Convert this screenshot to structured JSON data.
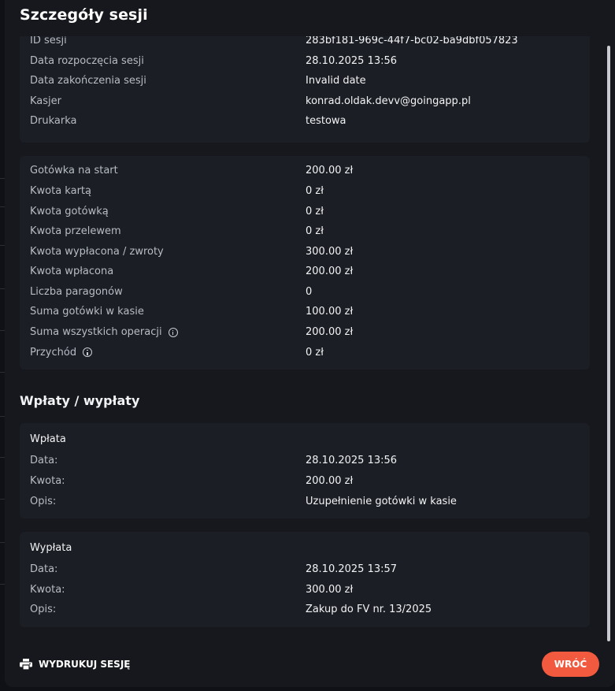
{
  "modal": {
    "title": "Szczegóły sesji"
  },
  "session": {
    "rows": [
      {
        "label": "ID sesji",
        "value": "283bf181-969c-44f7-bc02-ba9dbf057823"
      },
      {
        "label": "Data rozpoczęcia sesji",
        "value": "28.10.2025 13:56"
      },
      {
        "label": "Data zakończenia sesji",
        "value": "Invalid date"
      },
      {
        "label": "Kasjer",
        "value": "konrad.oldak.devv@goingapp.pl"
      },
      {
        "label": "Drukarka",
        "value": "testowa"
      }
    ]
  },
  "amounts": {
    "rows": [
      {
        "label": "Gotówka na start",
        "value": "200.00 zł"
      },
      {
        "label": "Kwota kartą",
        "value": "0 zł"
      },
      {
        "label": "Kwota gotówką",
        "value": "0 zł"
      },
      {
        "label": "Kwota przelewem",
        "value": "0 zł"
      },
      {
        "label": "Kwota wypłacona / zwroty",
        "value": "300.00 zł"
      },
      {
        "label": "Kwota wpłacona",
        "value": "200.00 zł"
      },
      {
        "label": "Liczba paragonów",
        "value": "0"
      },
      {
        "label": "Suma gotówki w kasie",
        "value": "100.00 zł"
      },
      {
        "label": "Suma wszystkich operacji",
        "value": "200.00 zł",
        "icon": "info-icon"
      },
      {
        "label": "Przychód",
        "value": "0 zł",
        "icon": "info-icon"
      }
    ]
  },
  "operations": {
    "title": "Wpłaty / wypłaty",
    "items": [
      {
        "type": "Wpłata",
        "rows": [
          {
            "label": "Data:",
            "value": "28.10.2025 13:56"
          },
          {
            "label": "Kwota:",
            "value": "200.00 zł"
          },
          {
            "label": "Opis:",
            "value": "Uzupełnienie gotówki w kasie"
          }
        ]
      },
      {
        "type": "Wypłata",
        "rows": [
          {
            "label": "Data:",
            "value": "28.10.2025 13:57"
          },
          {
            "label": "Kwota:",
            "value": "300.00 zł"
          },
          {
            "label": "Opis:",
            "value": "Zakup do FV nr. 13/2025"
          }
        ]
      }
    ]
  },
  "footer": {
    "print_label": "WYDRUKUJ SESJĘ",
    "print_icon": "printer-icon",
    "back_label": "WRÓĆ"
  },
  "colors": {
    "accent": "#f25a3f",
    "modal_bg": "#16181d",
    "card_bg": "#1b1e24"
  }
}
